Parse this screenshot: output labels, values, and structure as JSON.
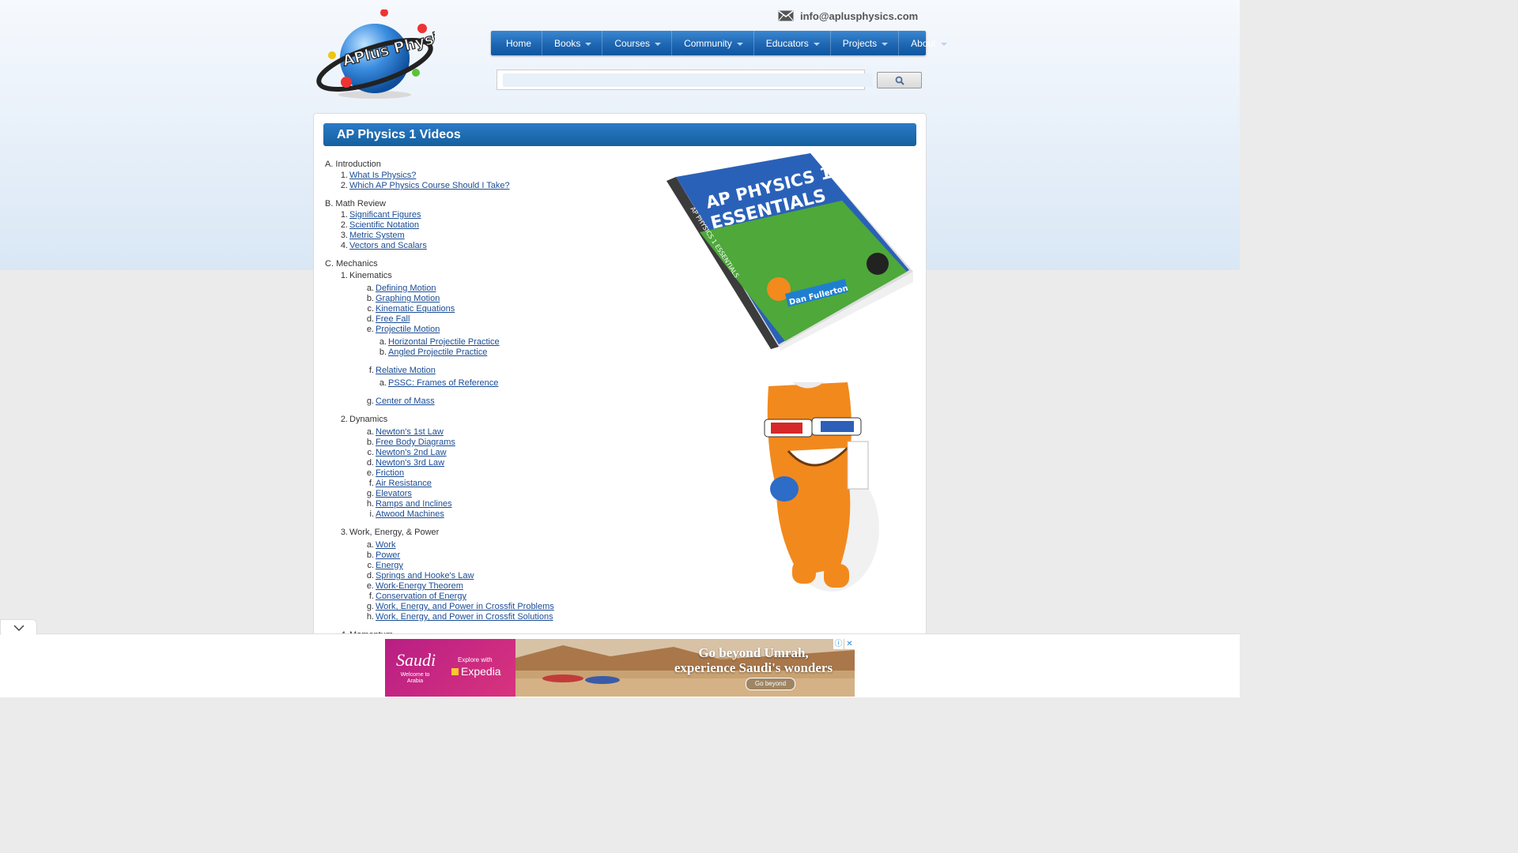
{
  "header": {
    "logo_alt": "APlus Physics",
    "email": "info@aplusphysics.com"
  },
  "nav": {
    "items": [
      {
        "label": "Home",
        "dropdown": false
      },
      {
        "label": "Books",
        "dropdown": true
      },
      {
        "label": "Courses",
        "dropdown": true
      },
      {
        "label": "Community",
        "dropdown": true
      },
      {
        "label": "Educators",
        "dropdown": true
      },
      {
        "label": "Projects",
        "dropdown": true
      },
      {
        "label": "About",
        "dropdown": true
      }
    ]
  },
  "search": {
    "value": "",
    "placeholder": ""
  },
  "page": {
    "title": "AP Physics 1 Videos"
  },
  "sections": [
    {
      "mark": "A.",
      "title": "Introduction",
      "items": [
        {
          "mark": "1.",
          "label": "What Is Physics?"
        },
        {
          "mark": "2.",
          "label": "Which AP Physics Course Should I Take?"
        }
      ]
    },
    {
      "mark": "B.",
      "title": "Math Review",
      "items": [
        {
          "mark": "1.",
          "label": "Significant Figures"
        },
        {
          "mark": "2.",
          "label": "Scientific Notation"
        },
        {
          "mark": "3.",
          "label": "Metric System"
        },
        {
          "mark": "4.",
          "label": "Vectors and Scalars"
        }
      ]
    },
    {
      "mark": "C.",
      "title": "Mechanics",
      "groups": [
        {
          "mark": "1.",
          "title": "Kinematics",
          "items": [
            {
              "mark": "a.",
              "label": "Defining Motion"
            },
            {
              "mark": "b.",
              "label": "Graphing Motion"
            },
            {
              "mark": "c.",
              "label": "Kinematic Equations"
            },
            {
              "mark": "d.",
              "label": "Free Fall"
            },
            {
              "mark": "e.",
              "label": "Projectile Motion",
              "children": [
                {
                  "mark": "a.",
                  "label": "Horizontal Projectile Practice"
                },
                {
                  "mark": "b.",
                  "label": "Angled Projectile Practice"
                }
              ]
            },
            {
              "mark": "f.",
              "label": "Relative Motion",
              "children": [
                {
                  "mark": "a.",
                  "label": "PSSC: Frames of Reference"
                }
              ]
            },
            {
              "mark": "g.",
              "label": "Center of Mass"
            }
          ]
        },
        {
          "mark": "2.",
          "title": "Dynamics",
          "items": [
            {
              "mark": "a.",
              "label": "Newton's 1st Law"
            },
            {
              "mark": "b.",
              "label": "Free Body Diagrams"
            },
            {
              "mark": "c.",
              "label": "Newton's 2nd Law"
            },
            {
              "mark": "d.",
              "label": "Newton's 3rd Law"
            },
            {
              "mark": "e.",
              "label": "Friction"
            },
            {
              "mark": "f.",
              "label": "Air Resistance"
            },
            {
              "mark": "g.",
              "label": "Elevators"
            },
            {
              "mark": "h.",
              "label": "Ramps and Inclines"
            },
            {
              "mark": "i.",
              "label": "Atwood Machines"
            }
          ]
        },
        {
          "mark": "3.",
          "title": "Work, Energy, & Power",
          "items": [
            {
              "mark": "a.",
              "label": "Work"
            },
            {
              "mark": "b.",
              "label": "Power"
            },
            {
              "mark": "c.",
              "label": "Energy"
            },
            {
              "mark": "d.",
              "label": "Springs and Hooke's Law"
            },
            {
              "mark": "e.",
              "label": "Work-Energy Theorem"
            },
            {
              "mark": "f.",
              "label": "Conservation of Energy"
            },
            {
              "mark": "g.",
              "label": "Work, Energy, and Power in Crossfit Problems"
            },
            {
              "mark": "h.",
              "label": "Work, Energy, and Power in Crossfit Solutions"
            }
          ]
        },
        {
          "mark": "4.",
          "title": "Momentum",
          "items": []
        }
      ]
    }
  ],
  "book": {
    "title_line1": "AP PHYSICS 1",
    "title_line2": "ESSENTIALS",
    "spine": "AP PHYSICS 1 ESSENTIALS",
    "author": "Dan Fullerton"
  },
  "ad": {
    "brand": "Saudi",
    "welcome": "Welcome to Arabia",
    "explore": "Explore with",
    "partner": "Expedia",
    "headline_line1": "Go beyond Umrah,",
    "headline_line2": "experience Saudi's wonders",
    "cta": "Go beyond"
  },
  "colors": {
    "nav": "#1f67b3",
    "title_bar": "#14609f",
    "link": "#1a4c95",
    "ad_brand": "#b81e84"
  }
}
